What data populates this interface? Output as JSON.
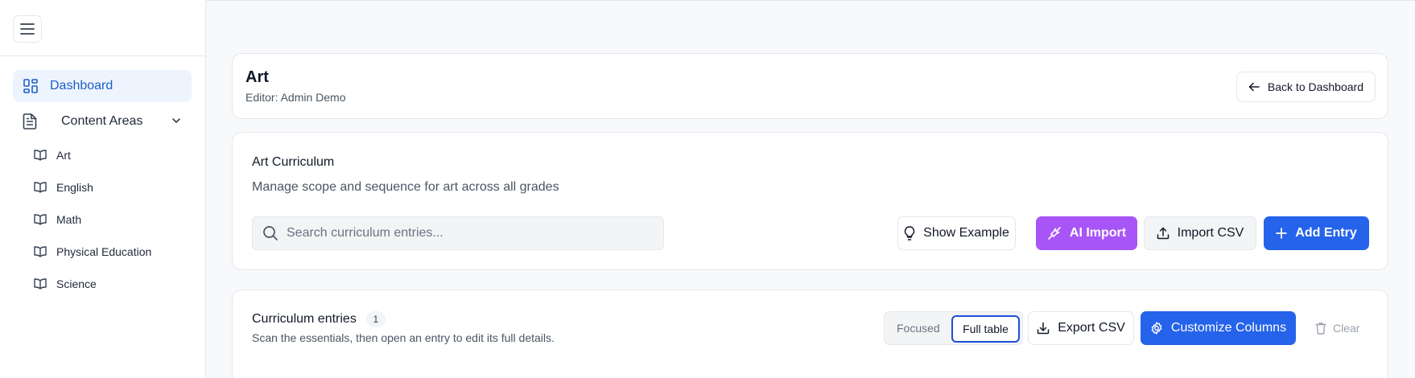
{
  "sidebar": {
    "dashboard_label": "Dashboard",
    "content_areas_label": "Content Areas",
    "items": [
      {
        "label": "Art"
      },
      {
        "label": "English"
      },
      {
        "label": "Math"
      },
      {
        "label": "Physical Education"
      },
      {
        "label": "Science"
      }
    ]
  },
  "header": {
    "title": "Art",
    "subtitle": "Editor: Admin Demo",
    "back_label": "Back to Dashboard"
  },
  "curriculum": {
    "title": "Art Curriculum",
    "description": "Manage scope and sequence for art across all grades",
    "search_placeholder": "Search curriculum entries...",
    "search_value": "",
    "show_example_label": "Show Example",
    "ai_import_label": "AI Import",
    "import_csv_label": "Import CSV",
    "add_entry_label": "Add Entry"
  },
  "entries": {
    "title": "Curriculum entries",
    "count": "1",
    "description": "Scan the essentials, then open an entry to edit its full details.",
    "view_focused_label": "Focused",
    "view_full_label": "Full table",
    "selected_view": "Full table",
    "export_csv_label": "Export CSV",
    "customize_columns_label": "Customize Columns",
    "clear_label": "Clear"
  },
  "colors": {
    "accent_blue": "#2563eb",
    "ai_purple": "#a855f7",
    "active_nav_bg": "#eef4fd",
    "active_nav_text": "#1d5fc9"
  }
}
